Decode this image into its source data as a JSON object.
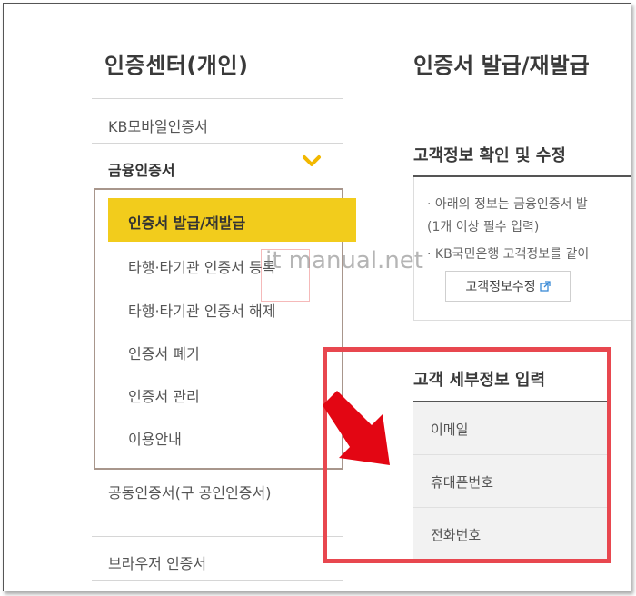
{
  "sidebar": {
    "title": "인증센터(개인)",
    "items": {
      "kb_mobile": "KB모바일인증서",
      "financial": "금융인증서",
      "joint": "공동인증서(구 공인인증서)",
      "browser": "브라우저 인증서"
    },
    "submenu": [
      {
        "label": "인증서 발급/재발급",
        "active": true
      },
      {
        "label": "타행·타기관 인증서 등록",
        "active": false
      },
      {
        "label": "타행·타기관 인증서 해제",
        "active": false
      },
      {
        "label": "인증서 폐기",
        "active": false
      },
      {
        "label": "인증서 관리",
        "active": false
      },
      {
        "label": "이용안내",
        "active": false
      }
    ],
    "chevron_icon": "chevron-down-icon"
  },
  "main": {
    "title": "인증서 발급/재발급",
    "section_title": "고객정보 확인 및 수정",
    "info_lines": [
      "· 아래의 정보는 금융인증서 발",
      "(1개 이상 필수 입력)",
      "· KB국민은행 고객정보를 같이"
    ],
    "edit_button": "고객정보수정",
    "detail_title": "고객 세부정보 입력",
    "detail_fields": [
      "이메일",
      "휴대폰번호",
      "전화번호"
    ]
  },
  "watermark": "it manual.net",
  "colors": {
    "accent_yellow": "#f2cc1c",
    "highlight_red": "#e8474f",
    "arrow_red": "#e30613"
  }
}
